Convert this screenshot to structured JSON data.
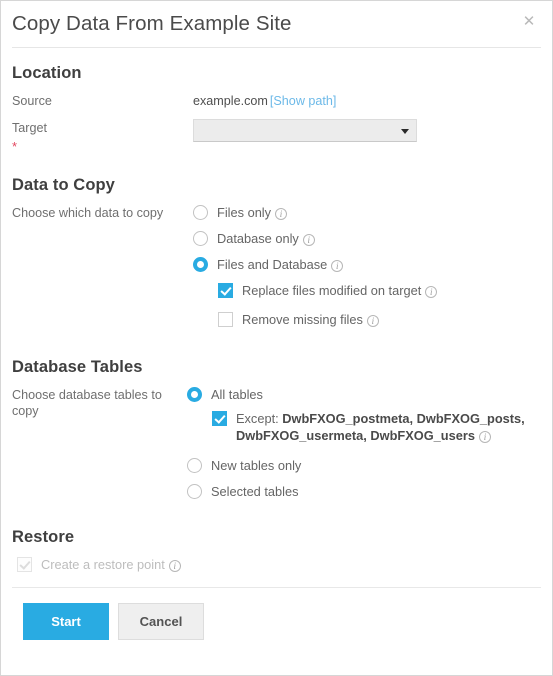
{
  "dialog": {
    "title": "Copy Data From Example Site",
    "close_icon": "close-icon"
  },
  "location": {
    "heading": "Location",
    "source_label": "Source",
    "source_value": "example.com",
    "show_path_link": "[Show path]",
    "target_label": "Target",
    "required_marker": "*",
    "target_value": "",
    "target_arrow_icon": "chevron-down-icon"
  },
  "data_to_copy": {
    "heading": "Data to Copy",
    "prompt": "Choose which data to copy",
    "options": [
      {
        "label": "Files only",
        "selected": false,
        "info": "info-icon"
      },
      {
        "label": "Database only",
        "selected": false,
        "info": "info-icon"
      },
      {
        "label": "Files and Database",
        "selected": true,
        "info": "info-icon"
      }
    ],
    "sub_options": [
      {
        "label": "Replace files modified on target",
        "checked": true,
        "info": "info-icon"
      },
      {
        "label": "Remove missing files",
        "checked": false,
        "info": "info-icon"
      }
    ]
  },
  "database_tables": {
    "heading": "Database Tables",
    "prompt": "Choose database tables to copy",
    "options": [
      {
        "label": "All tables",
        "selected": true
      },
      {
        "label": "New tables only",
        "selected": false
      },
      {
        "label": "Selected tables",
        "selected": false
      }
    ],
    "except": {
      "checked": true,
      "prefix": "Except:",
      "tables": "DwbFXOG_postmeta, DwbFXOG_posts, DwbFXOG_usermeta, DwbFXOG_users",
      "info": "info-icon"
    }
  },
  "restore": {
    "heading": "Restore",
    "checkbox_label": "Create a restore point",
    "checked": true,
    "disabled": true,
    "info": "info-icon"
  },
  "footer": {
    "start_label": "Start",
    "cancel_label": "Cancel"
  },
  "colors": {
    "accent": "#29abe2",
    "link": "#6cb9e8",
    "required": "#e2475f"
  }
}
